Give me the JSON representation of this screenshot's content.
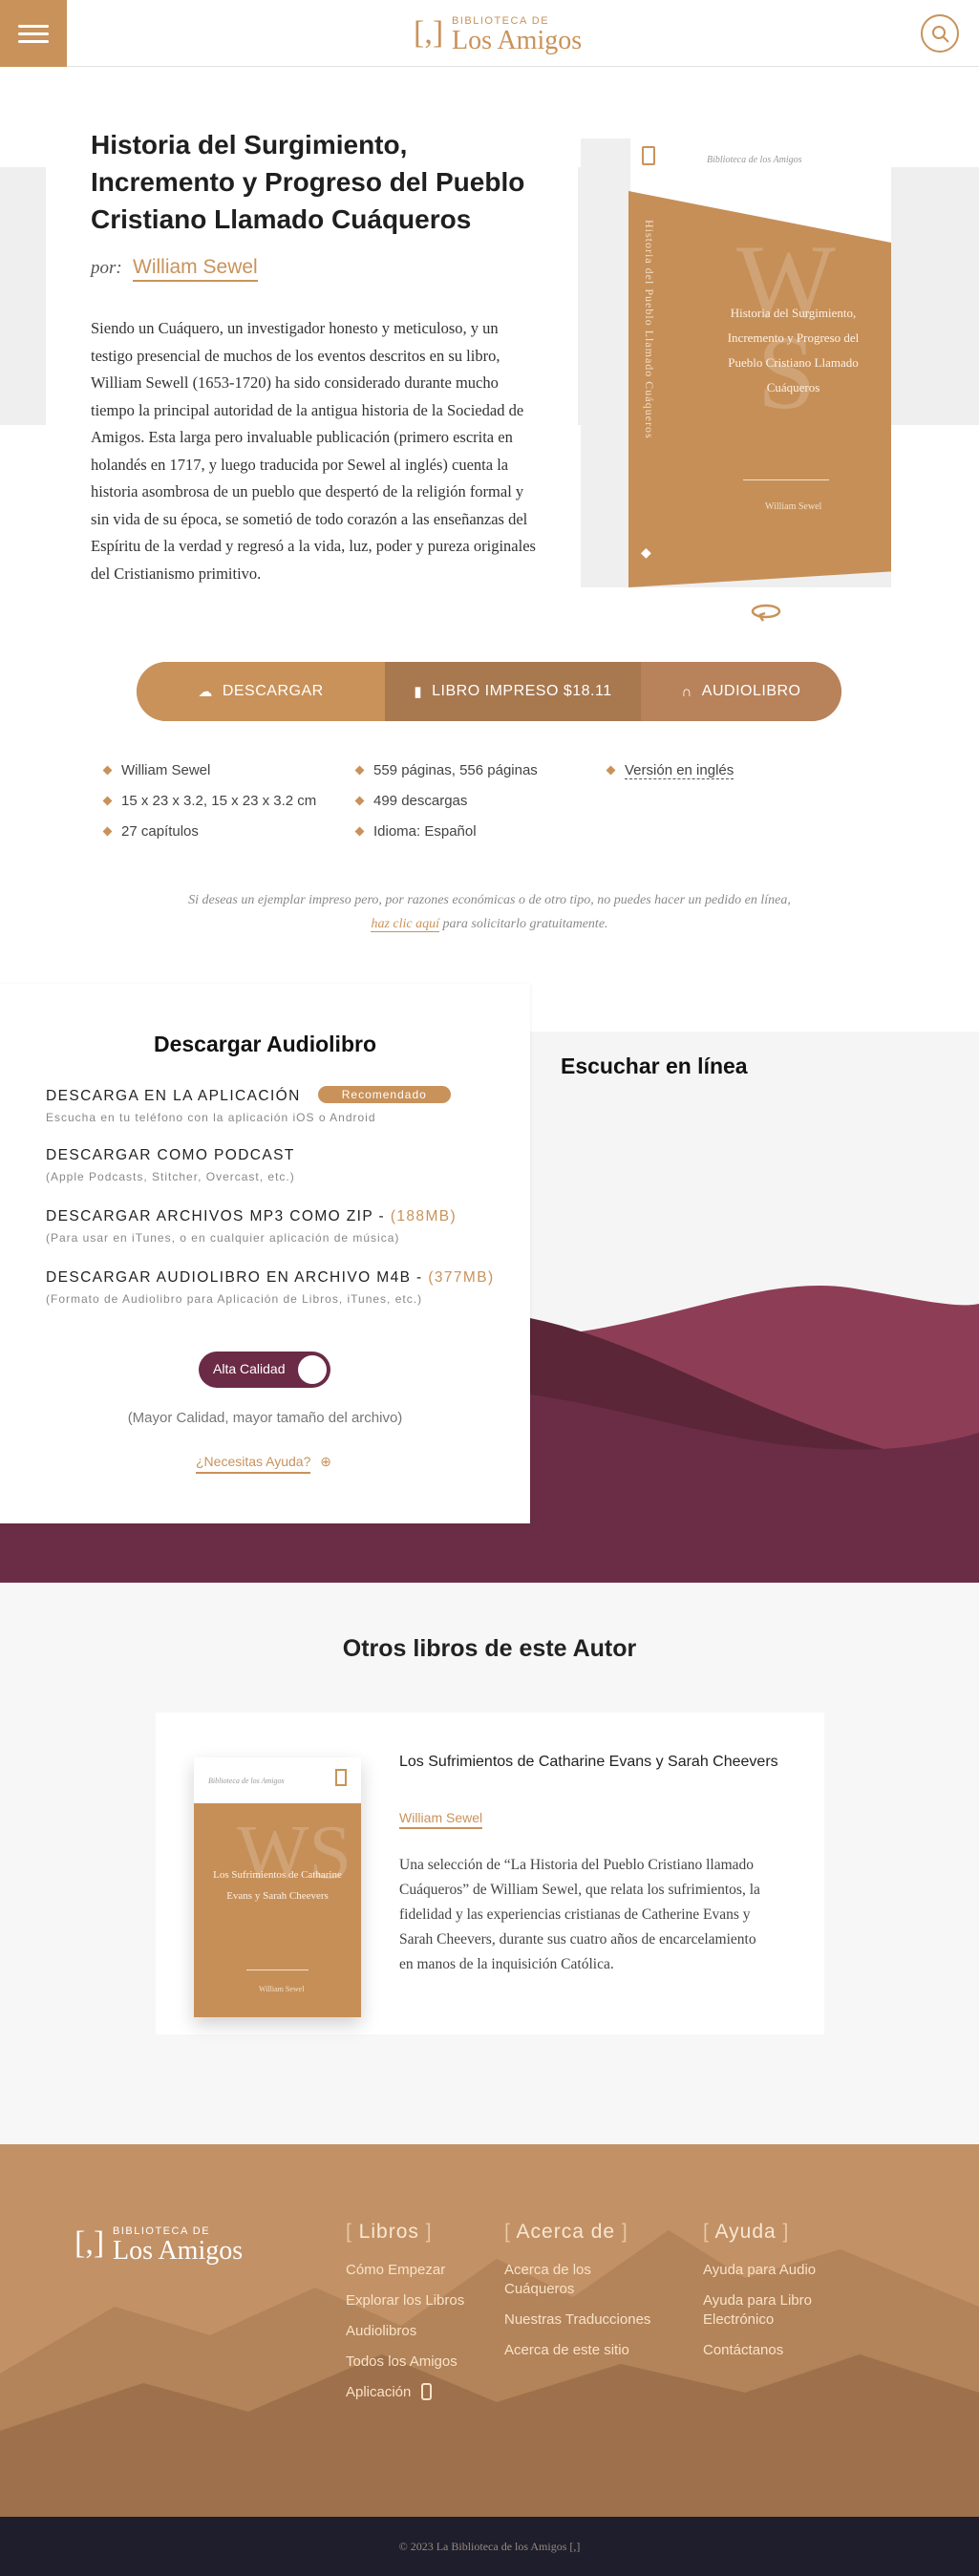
{
  "header": {
    "logo_small": "BIBLIOTECA DE",
    "logo_big": "Los Amigos",
    "logo_bracket": "[,]"
  },
  "book": {
    "title": "Historia del Surgimiento, Incremento y Progreso del Pueblo Cristiano Llamado Cuáqueros",
    "by_label": "por:",
    "author": "William Sewel",
    "description": "Siendo un Cuáquero, un investigador honesto y meticuloso, y un testigo presencial de muchos de los eventos descritos en su libro, William Sewell (1653-1720) ha sido considerado durante mucho tiempo la principal autoridad de la antigua historia de la Sociedad de Amigos. Esta larga pero invaluable publicación (primero escrita en holandés en 1717, y luego traducida por Sewel al inglés) cuenta la historia asombrosa de un pueblo que despertó de la religión formal y sin vida de su época, se sometió de todo corazón a las enseñanzas del Espíritu de la verdad y regresó a la vida, luz, poder y pureza originales del Cristianismo primitivo.",
    "cover": {
      "back_tiny": "Biblioteca de los Amigos",
      "spine": "Historia del Pueblo Llamado Cuáqueros",
      "monogram_1": "W",
      "monogram_2": "S",
      "title": "Historia del Surgimiento, Incremento y Progreso del Pueblo Cristiano Llamado Cuáqueros",
      "author": "William Sewel"
    }
  },
  "actions": {
    "download": "DESCARGAR",
    "print": "LIBRO IMPRESO $18.11",
    "audio": "AUDIOLIBRO"
  },
  "meta": {
    "col1": [
      "William Sewel",
      "15 x 23 x 3.2, 15 x 23 x 3.2 cm",
      "27 capítulos"
    ],
    "col2": [
      "559 páginas, 556 páginas",
      "499 descargas",
      "Idioma: Español"
    ],
    "col3": [
      "Versión en inglés"
    ]
  },
  "note": {
    "before": "Si deseas un ejemplar impreso pero, por razones económicas o de otro tipo, no puedes hacer un pedido en línea,",
    "link": "haz clic aquí",
    "after": "para solicitarlo gratuitamente."
  },
  "audio": {
    "title": "Descargar Audiolibro",
    "listen_title": "Escuchar en línea",
    "items": [
      {
        "title": "DESCARGA EN LA APLICACIÓN",
        "sub": "Escucha en tu teléfono con la aplicación iOS o Android",
        "badge": "Recomendado"
      },
      {
        "title": "DESCARGAR COMO PODCAST",
        "sub": "(Apple Podcasts, Stitcher, Overcast, etc.)"
      },
      {
        "title": "DESCARGAR ARCHIVOS MP3 COMO ZIP -",
        "size": "(188MB)",
        "sub": "(Para usar en iTunes, o en cualquier aplicación de música)"
      },
      {
        "title": "DESCARGAR AUDIOLIBRO EN ARCHIVO M4B -",
        "size": "(377MB)",
        "sub": "(Formato de Audiolibro para Aplicación de Libros, iTunes, etc.)"
      }
    ],
    "toggle_label": "Alta Calidad",
    "quality_note": "(Mayor Calidad, mayor tamaño del archivo)",
    "help": "¿Necesitas Ayuda?"
  },
  "others": {
    "heading": "Otros libros de este Autor",
    "book": {
      "title": "Los Sufrimientos de Catharine Evans y Sarah Cheevers",
      "author": "William Sewel",
      "description": "Una selección de “La Historia del Pueblo Cristiano llamado Cuáqueros” de William Sewel, que relata los sufrimientos, la fidelidad y las experiencias cristianas de Catherine Evans y Sarah Cheevers, durante sus cuatro años de encarcelamiento en manos de la inquisición Católica.",
      "cover_tiny": "Biblioteca de los Amigos",
      "cover_title": "Los Sufrimientos de Catharine Evans y Sarah Cheevers",
      "cover_author": "William Sewel",
      "monogram": "WS"
    }
  },
  "footer": {
    "columns": [
      {
        "heading": "Libros",
        "links": [
          "Cómo Empezar",
          "Explorar los Libros",
          "Audiolibros",
          "Todos los Amigos",
          "Aplicación"
        ]
      },
      {
        "heading": "Acerca de",
        "links": [
          "Acerca de los Cuáqueros",
          "Nuestras Traducciones",
          "Acerca de este sitio"
        ]
      },
      {
        "heading": "Ayuda",
        "links": [
          "Ayuda para Audio",
          "Ayuda para Libro Electrónico",
          "Contáctanos"
        ]
      }
    ],
    "copyright": "© 2023 La Biblioteca de los Amigos [,]"
  },
  "colors": {
    "accent": "#c9925a",
    "wine": "#6b2a45",
    "footer_bg": "#c29165",
    "copyright_bg": "#1e1e2d"
  }
}
